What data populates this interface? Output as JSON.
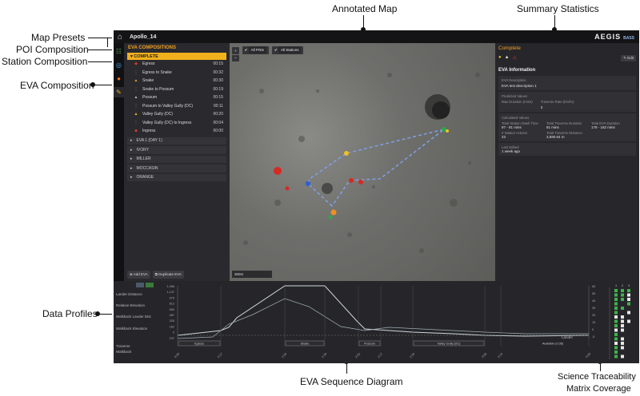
{
  "annotations": {
    "annotated_map": "Annotated Map",
    "summary_statistics": "Summary Statistics",
    "map_presets": "Map Presets",
    "poi_composition": "POI Composition",
    "station_composition": "Station Composition",
    "eva_composition": "EVA Composition",
    "data_profiles": "Data Profiles",
    "eva_sequence_diagram": "EVA Sequence Diagram",
    "stm_coverage_line1": "Science Traceability",
    "stm_coverage_line2": "Matrix Coverage"
  },
  "topbar": {
    "title": "Apollo_14",
    "brand": "AEGIS",
    "brand_sub": "BASS"
  },
  "left_panel": {
    "header": "EVA COMPOSITIONS",
    "expanded_label": "COMPLETE",
    "activities": [
      {
        "name": "Egress",
        "time": "00:15",
        "icon": "egress-icon",
        "color": "#e03a2a"
      },
      {
        "name": "Egress to Snake",
        "time": "00:32",
        "icon": "traverse-icon",
        "color": "#f0c020"
      },
      {
        "name": "Snake",
        "time": "00:30",
        "icon": "station-icon",
        "color": "#f0a020"
      },
      {
        "name": "Snake to Possum",
        "time": "00:19",
        "icon": "traverse-icon",
        "color": "#f0c020"
      },
      {
        "name": "Possum",
        "time": "00:15",
        "icon": "station-icon",
        "color": "#bbbbbb"
      },
      {
        "name": "Possum to Valley Gully (DC)",
        "time": "00:11",
        "icon": "traverse-icon",
        "color": "#f0c020"
      },
      {
        "name": "Valley Gully (DC)",
        "time": "00:20",
        "icon": "station-icon",
        "color": "#f0c020"
      },
      {
        "name": "Valley Gully (DC) to Ingress",
        "time": "00:04",
        "icon": "traverse-icon",
        "color": "#f0c020"
      },
      {
        "name": "Ingress",
        "time": "00:00",
        "icon": "ingress-icon",
        "color": "#e03a2a"
      }
    ],
    "groups": [
      "EVA 1 (DAY 1)",
      "IVORY",
      "MILLER",
      "MOCCASIN",
      "ORANGE"
    ],
    "add_eva": "Add EVA",
    "duplicate_eva": "Duplicate EVA"
  },
  "map": {
    "add_label": "+",
    "minus_label": "−",
    "all_pois": "All POIs",
    "all_stations": "All Stations",
    "scale": "300m"
  },
  "right_panel": {
    "status": "Complete",
    "edit": "Edit",
    "section": "EVA Information",
    "description_label": "EVA Description",
    "description_value": "EVA test description 1",
    "predicted_label": "Predicted Values",
    "max_duration_label": "Max Duration (mins)",
    "traverse_rate_label": "Traverse Rate (km/hr)",
    "traverse_rate_value": "3",
    "calculated_label": "Calculated Values",
    "dwell_label": "Total Station Dwell Time",
    "dwell_value": "97 - 81 mins",
    "traverse_dur_label": "Total Traverse Duration",
    "traverse_dur_value": "81 mins",
    "eva_dur_label": "Total EVA Duration",
    "eva_dur_value": "178 - 162 mins",
    "station_actions_label": "# Station Actions",
    "station_actions_value": "23",
    "traverse_dist_label": "Total Traverse Distance",
    "traverse_dist_value": "3,590.64 m",
    "last_edited_label": "Last Edited",
    "last_edited_value": "1 week ago"
  },
  "profiles": {
    "row_labels": [
      "Lander Distance",
      "Relative Elevation",
      "Walkback Lander Dist",
      "Walkback Elevation"
    ],
    "lander_label": "Lander",
    "traverse_label": "Traverse",
    "walkback_label": "Walkback",
    "left_axis_ticks": [
      "1,398",
      "1,137",
      "975",
      "812",
      "650",
      "487",
      "325",
      "162",
      "0",
      "247"
    ],
    "right_axis_ticks": [
      "65",
      "55",
      "45",
      "35",
      "25",
      "15",
      "5",
      "-5"
    ],
    "sequence_labels": [
      "Egress",
      "Snake",
      "Possum",
      "Valley Gully (DC)",
      "Available (0:36)"
    ],
    "time_ticks": [
      "0:00",
      "0:17",
      "1:04",
      "1:34",
      "2:02",
      "2:17",
      "2:34",
      "3:06",
      "3:14",
      "4:00"
    ],
    "stm_cols": [
      "1",
      "2",
      "3"
    ]
  }
}
